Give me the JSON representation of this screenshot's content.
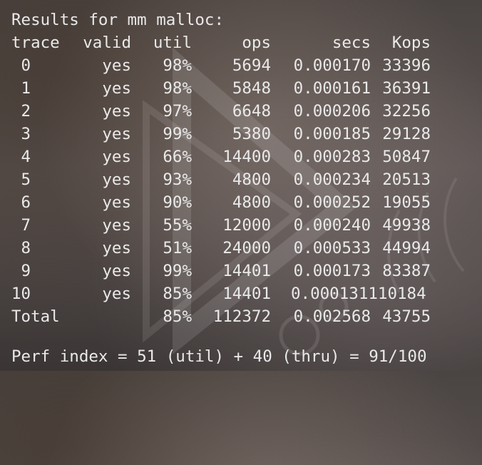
{
  "title": "Results for mm malloc:",
  "headers": {
    "trace": "trace",
    "valid": "valid",
    "util": "util",
    "ops": "ops",
    "secs": "secs",
    "kops": "Kops"
  },
  "rows": [
    {
      "trace": " 0",
      "valid": "yes",
      "util": "98%",
      "ops": "5694",
      "secs": "0.000170",
      "kops": "33396"
    },
    {
      "trace": " 1",
      "valid": "yes",
      "util": "98%",
      "ops": "5848",
      "secs": "0.000161",
      "kops": "36391"
    },
    {
      "trace": " 2",
      "valid": "yes",
      "util": "97%",
      "ops": "6648",
      "secs": "0.000206",
      "kops": "32256"
    },
    {
      "trace": " 3",
      "valid": "yes",
      "util": "99%",
      "ops": "5380",
      "secs": "0.000185",
      "kops": "29128"
    },
    {
      "trace": " 4",
      "valid": "yes",
      "util": "66%",
      "ops": "14400",
      "secs": "0.000283",
      "kops": "50847"
    },
    {
      "trace": " 5",
      "valid": "yes",
      "util": "93%",
      "ops": "4800",
      "secs": "0.000234",
      "kops": "20513"
    },
    {
      "trace": " 6",
      "valid": "yes",
      "util": "90%",
      "ops": "4800",
      "secs": "0.000252",
      "kops": "19055"
    },
    {
      "trace": " 7",
      "valid": "yes",
      "util": "55%",
      "ops": "12000",
      "secs": "0.000240",
      "kops": "49938"
    },
    {
      "trace": " 8",
      "valid": "yes",
      "util": "51%",
      "ops": "24000",
      "secs": "0.000533",
      "kops": "44994"
    },
    {
      "trace": " 9",
      "valid": "yes",
      "util": "99%",
      "ops": "14401",
      "secs": "0.000173",
      "kops": "83387"
    },
    {
      "trace": "10",
      "valid": "yes",
      "util": "85%",
      "ops": "14401",
      "secs": "0.000131110184",
      "kops": ""
    }
  ],
  "total": {
    "label": "Total",
    "util": "85%",
    "ops": "112372",
    "secs": "0.002568",
    "kops": "43755"
  },
  "perf_index": "Perf index = 51 (util) + 40 (thru) = 91/100",
  "colors": {
    "text": "#e9e9e9"
  }
}
